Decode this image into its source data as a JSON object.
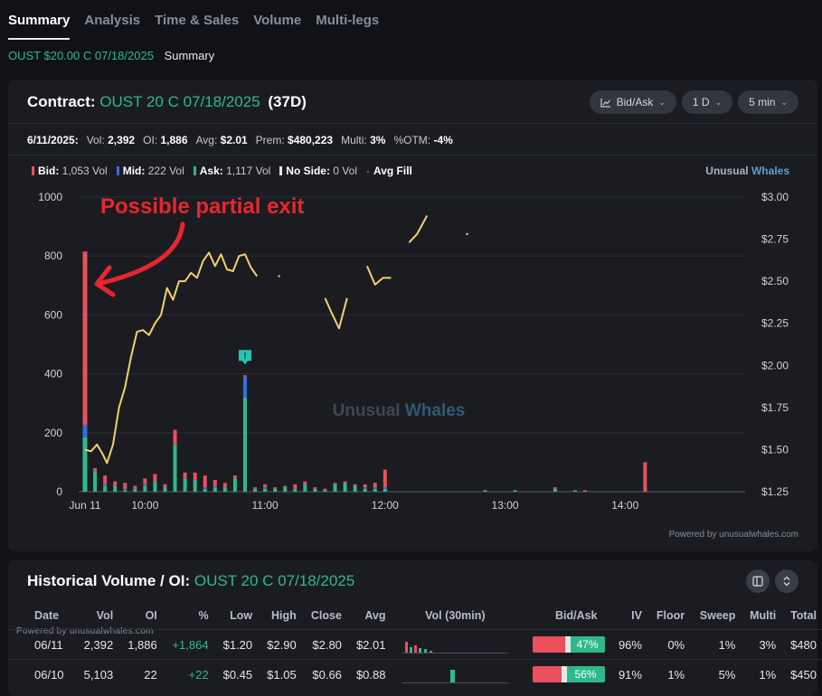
{
  "tabs": [
    "Summary",
    "Analysis",
    "Time & Sales",
    "Volume",
    "Multi-legs"
  ],
  "breadcrumb": {
    "contract": "OUST $20.00 C 07/18/2025",
    "page": "Summary"
  },
  "contract_card": {
    "title_label": "Contract:",
    "contract": "OUST 20 C 07/18/2025",
    "dte": "(37D)",
    "controls": {
      "chart_type": "Bid/Ask",
      "range": "1 D",
      "interval": "5 min"
    },
    "stats": {
      "date": "6/11/2025:",
      "vol_label": "Vol:",
      "vol": "2,392",
      "oi_label": "OI:",
      "oi": "1,886",
      "avg_label": "Avg:",
      "avg": "$2.01",
      "prem_label": "Prem:",
      "prem": "$480,223",
      "multi_label": "Multi:",
      "multi": "3%",
      "otm_label": "%OTM:",
      "otm": "-4%"
    },
    "legend": {
      "bid": "Bid:",
      "bid_val": "1,053 Vol",
      "mid": "Mid:",
      "mid_val": "222 Vol",
      "ask": "Ask:",
      "ask_val": "1,117 Vol",
      "noside": "No Side:",
      "noside_val": "0 Vol",
      "avgfill": "Avg Fill"
    },
    "brand": {
      "w1": "Unusual",
      "w2": "Whales"
    },
    "watermark": {
      "w1": "Unusual",
      "w2": "Whales"
    },
    "annotation": "Possible partial exit",
    "marker_glyph": "!",
    "powered": "Powered by unusualwhales.com",
    "colors": {
      "bid": "#e9505c",
      "mid": "#2f6fe0",
      "ask": "#2fb98a",
      "avg": "#f2d06b",
      "annotation": "#e8262f"
    }
  },
  "chart_data": {
    "type": "bar",
    "x_ticks": [
      "Jun 11",
      "10:00",
      "11:00",
      "12:00",
      "13:00",
      "14:00"
    ],
    "y_left": {
      "ticks": [
        "1000",
        "800",
        "600",
        "400",
        "200",
        "0"
      ],
      "ylim": [
        0,
        1000
      ]
    },
    "y_right": {
      "ticks": [
        "$3.00",
        "$2.75",
        "$2.50",
        "$2.25",
        "$2.00",
        "$1.75",
        "$1.50",
        "$1.25"
      ],
      "ylim": [
        1.25,
        3.0
      ]
    },
    "bars_minutes_after_open": [
      0,
      5,
      10,
      15,
      20,
      25,
      30,
      35,
      40,
      45,
      50,
      55,
      60,
      65,
      70,
      75,
      80,
      85,
      90,
      95,
      100,
      105,
      110,
      115,
      120,
      125,
      130,
      135,
      140,
      145,
      150,
      165,
      170,
      175,
      180,
      200,
      215,
      235,
      245,
      250,
      280
    ],
    "series": [
      {
        "name": "Bid",
        "values": [
          590,
          10,
          30,
          15,
          20,
          10,
          20,
          25,
          10,
          50,
          20,
          25,
          40,
          20,
          15,
          10,
          5,
          5,
          10,
          5,
          5,
          15,
          10,
          5,
          5,
          5,
          5,
          5,
          10,
          15,
          60,
          0,
          0,
          0,
          0,
          0,
          0,
          5,
          0,
          5,
          100
        ]
      },
      {
        "name": "Mid",
        "values": [
          40,
          0,
          5,
          0,
          5,
          0,
          5,
          0,
          0,
          0,
          0,
          0,
          5,
          5,
          0,
          0,
          70,
          0,
          5,
          0,
          0,
          0,
          0,
          0,
          0,
          0,
          0,
          0,
          5,
          5,
          5,
          0,
          0,
          0,
          0,
          0,
          0,
          0,
          0,
          0,
          0
        ]
      },
      {
        "name": "Ask",
        "values": [
          185,
          70,
          20,
          20,
          5,
          10,
          20,
          35,
          15,
          160,
          45,
          40,
          10,
          15,
          15,
          45,
          320,
          10,
          10,
          10,
          15,
          10,
          25,
          10,
          5,
          25,
          30,
          20,
          10,
          10,
          10,
          0,
          0,
          0,
          0,
          5,
          5,
          10,
          5,
          0,
          0
        ]
      }
    ],
    "avg_fill": [
      [
        0,
        1.5
      ],
      [
        3,
        1.49
      ],
      [
        6,
        1.53
      ],
      [
        9,
        1.47
      ],
      [
        11,
        1.42
      ],
      [
        14,
        1.53
      ],
      [
        17,
        1.75
      ],
      [
        20,
        1.87
      ],
      [
        23,
        2.05
      ],
      [
        26,
        2.2
      ],
      [
        29,
        2.21
      ],
      [
        32,
        2.18
      ],
      [
        35,
        2.25
      ],
      [
        38,
        2.3
      ],
      [
        41,
        2.46
      ],
      [
        44,
        2.39
      ],
      [
        47,
        2.5
      ],
      [
        50,
        2.5
      ],
      [
        53,
        2.55
      ],
      [
        56,
        2.52
      ],
      [
        59,
        2.62
      ],
      [
        62,
        2.67
      ],
      [
        65,
        2.59
      ],
      [
        68,
        2.66
      ],
      [
        71,
        2.57
      ],
      [
        74,
        2.56
      ],
      [
        77,
        2.65
      ],
      [
        80,
        2.66
      ],
      [
        83,
        2.58
      ],
      [
        86,
        2.53
      ],
      null,
      [
        97,
        2.53
      ],
      null,
      [
        120,
        2.4
      ],
      [
        123,
        2.32
      ],
      [
        127,
        2.22
      ],
      [
        131,
        2.4
      ],
      null,
      [
        141,
        2.59
      ],
      [
        145,
        2.48
      ],
      [
        149,
        2.52
      ],
      [
        153,
        2.52
      ],
      null,
      [
        162,
        2.73
      ],
      [
        166,
        2.78
      ],
      [
        171,
        2.89
      ],
      null,
      [
        191,
        2.78
      ]
    ]
  },
  "history": {
    "title_label": "Historical Volume / OI:",
    "contract": "OUST 20 C 07/18/2025",
    "powered": "Powered by unusualwhales.com",
    "columns": [
      "Date",
      "Vol",
      "OI",
      "%",
      "Low",
      "High",
      "Close",
      "Avg",
      "Vol (30min)",
      "Bid/Ask",
      "IV",
      "Floor",
      "Sweep",
      "Multi",
      "Total"
    ],
    "rows": [
      {
        "date": "06/11",
        "vol": "2,392",
        "oi": "1,886",
        "chg": "+1,864",
        "low": "$1.20",
        "high": "$2.90",
        "close": "$2.80",
        "avg": "$2.01",
        "ba_pct": "47%",
        "iv": "96%",
        "floor": "0%",
        "sweep": "1%",
        "multi": "3%",
        "total": "$480"
      },
      {
        "date": "06/10",
        "vol": "5,103",
        "oi": "22",
        "chg": "+22",
        "low": "$0.45",
        "high": "$1.05",
        "close": "$0.66",
        "avg": "$0.88",
        "ba_pct": "56%",
        "iv": "91%",
        "floor": "1%",
        "sweep": "5%",
        "multi": "1%",
        "total": "$450"
      }
    ]
  }
}
